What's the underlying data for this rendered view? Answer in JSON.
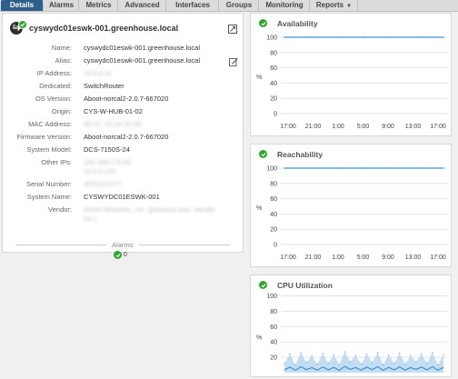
{
  "tabs": [
    {
      "label": "Details",
      "active": true
    },
    {
      "label": "Alarms",
      "active": false
    },
    {
      "label": "Metrics",
      "active": false
    },
    {
      "label": "Advanced",
      "active": false
    },
    {
      "label": "Interfaces",
      "active": false
    },
    {
      "label": "Groups",
      "active": false
    },
    {
      "label": "Monitoring",
      "active": false
    },
    {
      "label": "Reports",
      "active": false,
      "dropdown": true
    }
  ],
  "device": {
    "title": "cyswydc01eswk-001.greenhouse.local",
    "icon": "network-device-icon",
    "status": "ok",
    "properties": [
      {
        "label": "Name:",
        "value": "cyswydc01eswk-001.greenhouse.local"
      },
      {
        "label": "Alias:",
        "value": "cyswydc01eswk-001.greenhouse.local"
      },
      {
        "label": "IP Address:",
        "value": "10.0.0.11",
        "redacted": true
      },
      {
        "label": "Dedicated:",
        "value": "SwitchRouter"
      },
      {
        "label": "OS Version:",
        "value": "Aboot-norcal2-2.0.7-667020"
      },
      {
        "label": "Origin:",
        "value": "CYS-W-HUB-01-02"
      },
      {
        "label": "MAC Address:",
        "value": "00:1C:73:1A:2F:0D",
        "redacted": true
      },
      {
        "label": "Firmware Version:",
        "value": "Aboot-norcal2-2.0.7-667020"
      },
      {
        "label": "System Model:",
        "value": "DCS-7150S-24"
      },
      {
        "label": "Other IPs:",
        "value": "192.168.175.93",
        "value2": "10.0.0.129",
        "redacted": true
      },
      {
        "label": "Serial Number:",
        "value": "JPE1321177",
        "redacted": true
      },
      {
        "label": "System Name:",
        "value": "CYSWYDC01ESWK-001"
      },
      {
        "label": "Vendor:",
        "value": "Arista Networks, Inc. (previous was: Vendor",
        "value2": "Inc.)",
        "redacted": true
      }
    ],
    "alarms": {
      "title": "Alarms",
      "count": "0"
    }
  },
  "colors": {
    "tab_active": "#2c5f8a",
    "ok_green": "#2fa82f",
    "series_line": "#3f93d4",
    "series_fill": "#a9cfee"
  },
  "charts": [
    {
      "title": "Availability",
      "chart_data": {
        "type": "line",
        "title": "Availability",
        "x": [
          "17:00",
          "21:00",
          "1:00",
          "5:00",
          "9:00",
          "13:00",
          "17:00"
        ],
        "series": [
          {
            "values": [
              100,
              100,
              100,
              100,
              100,
              100,
              100
            ]
          }
        ],
        "yticks": [
          0,
          20,
          40,
          60,
          80,
          100
        ],
        "ylim": [
          0,
          100
        ],
        "ylabel_icon": "%",
        "grid": true
      }
    },
    {
      "title": "Reachability",
      "chart_data": {
        "type": "line",
        "title": "Reachability",
        "x": [
          "17:00",
          "21:00",
          "1:00",
          "5:00",
          "9:00",
          "13:00",
          "17:00"
        ],
        "series": [
          {
            "values": [
              100,
              100,
              100,
              100,
              100,
              100,
              100
            ]
          }
        ],
        "yticks": [
          0,
          20,
          40,
          60,
          80,
          100
        ],
        "ylim": [
          0,
          100
        ],
        "ylabel_icon": "%",
        "grid": true
      }
    },
    {
      "title": "CPU Utilization",
      "chart_data": {
        "type": "area",
        "title": "CPU Utilization",
        "series": [
          {
            "values": [
              12,
              24,
              10,
              26,
              13,
              22,
              11,
              25,
              12,
              23,
              10,
              27,
              14,
              22,
              11,
              24,
              13,
              26,
              10,
              23,
              12,
              25,
              11,
              22,
              14,
              24,
              12,
              26,
              10,
              23
            ]
          }
        ],
        "yticks": [
          20,
          40,
          60,
          80,
          100
        ],
        "ylim": [
          0,
          110
        ],
        "ylabel_icon": "%",
        "grid": true
      }
    }
  ]
}
